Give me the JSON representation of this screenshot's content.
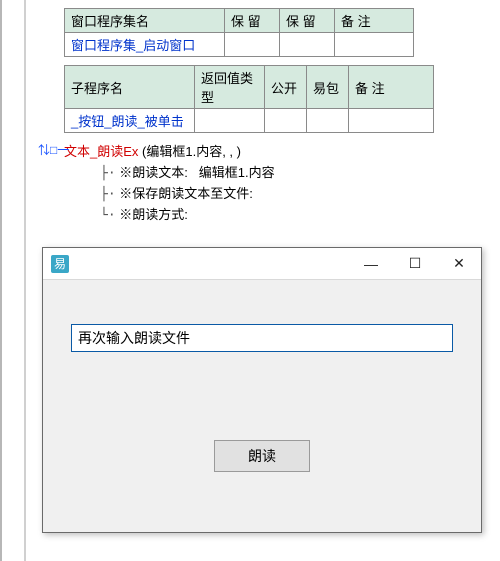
{
  "table1": {
    "headers": [
      "窗口程序集名",
      "保 留",
      "保 留",
      "备 注"
    ],
    "row": [
      "窗口程序集_启动窗口",
      "",
      "",
      ""
    ]
  },
  "table2": {
    "headers": [
      "子程序名",
      "返回值类型",
      "公开",
      "易包",
      "备 注"
    ],
    "row": [
      "_按钮_朗读_被单击",
      "",
      "",
      "",
      ""
    ]
  },
  "marker": "⇅□一",
  "code": {
    "call_fn": "文本_朗读Ex",
    "call_args": "(编辑框1.内容,  ,  )",
    "l1_prefix": "※朗读文本:",
    "l1_val": "编辑框1.内容",
    "l2": "※保存朗读文本至文件:",
    "l3": "※朗读方式:"
  },
  "window": {
    "icon": "易",
    "title": "",
    "minimize": "—",
    "maximize": "☐",
    "close": "✕",
    "input_value": "再次输入朗读文件",
    "speak_label": "朗读"
  }
}
